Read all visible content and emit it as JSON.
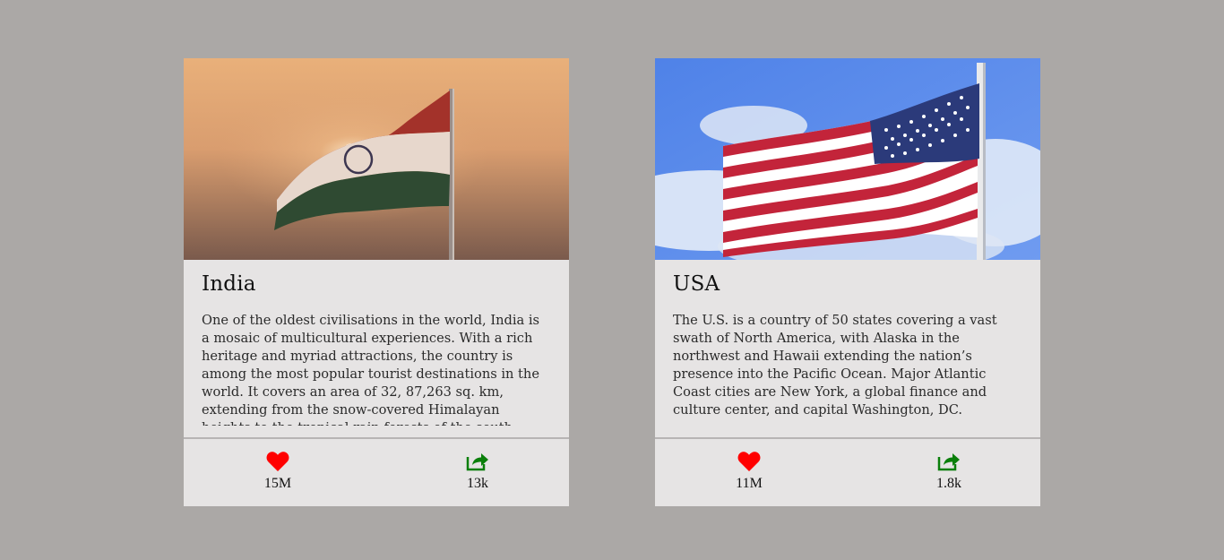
{
  "cards": [
    {
      "title": "India",
      "text": "One of the oldest civilisations in the world, India is a mosaic of multicultural experiences. With a rich heritage and myriad attractions, the country is among the most popular tourist destinations in the world. It covers an area of 32, 87,263 sq. km, extending from the snow-covered Himalayan heights to the tropical rain forests of the south.",
      "image_icon": "india-flag-photo",
      "likes": "15M",
      "shares": "13k"
    },
    {
      "title": "USA",
      "text": "The U.S. is a country of 50 states covering a vast swath of North America, with Alaska in the northwest and Hawaii extending the nation’s presence into the Pacific Ocean. Major Atlantic Coast cities are New York, a global finance and culture center, and capital Washington, DC.",
      "image_icon": "usa-flag-photo",
      "likes": "11M",
      "shares": "1.8k"
    }
  ],
  "colors": {
    "page_background": "#aba8a6",
    "card_background": "#e6e4e4",
    "like_icon": "#ff0000",
    "share_icon": "#0a7f0a"
  },
  "icons": {
    "like": "heart-icon",
    "share": "share-icon"
  }
}
